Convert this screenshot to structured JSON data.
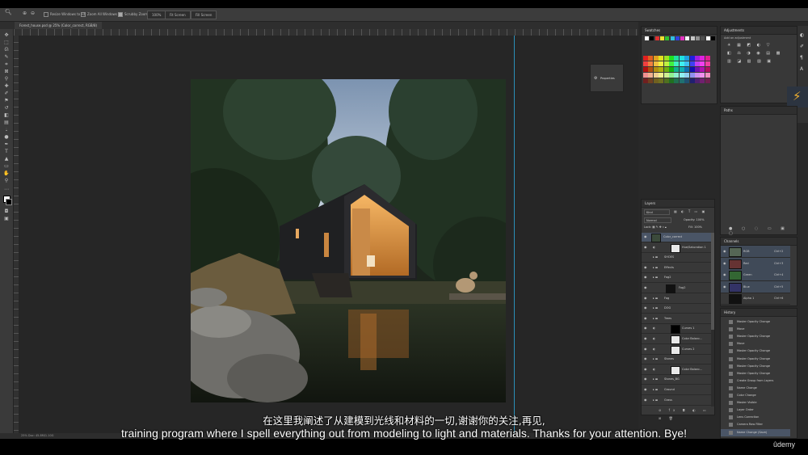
{
  "options_bar": {
    "resize_windows": "Resize Windows to Fit",
    "zoom_all_windows": "Zoom All Windows",
    "scrubby_zoom": "Scrubby Zoom",
    "zoom_100": "100%",
    "fit_screen": "Fit Screen",
    "fill_screen": "Fill Screen"
  },
  "document": {
    "tab_title": "Forest_house.psd @ 25% (Color_correct, RGB/8)",
    "status": "25%    Doc: 45.8M/1.10G"
  },
  "properties_panel": {
    "label": "Properties"
  },
  "swatches_panel": {
    "title": "Swatches",
    "top_row": [
      "#ffffff",
      "#000000",
      "#e03030",
      "#f0e030",
      "#30c030",
      "#30c0e0",
      "#3040e0",
      "#e030c0",
      "#f4f4f4",
      "#c8c8c8",
      "#909090",
      "#505050",
      "#ffffff",
      "#000000"
    ],
    "grid": [
      [
        "#e02020",
        "#e06020",
        "#e0a020",
        "#e0e020",
        "#a0e020",
        "#20e020",
        "#20e0a0",
        "#20e0e0",
        "#20a0e0",
        "#2020e0",
        "#a020e0",
        "#e020e0",
        "#e02090"
      ],
      [
        "#f04040",
        "#f08040",
        "#f0c040",
        "#f0f040",
        "#c0f040",
        "#40f040",
        "#40f0c0",
        "#40f0f0",
        "#40c0f0",
        "#4040f0",
        "#c040f0",
        "#f040f0",
        "#f040a0"
      ],
      [
        "#b01010",
        "#b05010",
        "#b09010",
        "#b0b010",
        "#70b010",
        "#10b010",
        "#10b090",
        "#10b0b0",
        "#1070b0",
        "#1010b0",
        "#7010b0",
        "#b010b0",
        "#b01060"
      ],
      [
        "#f09090",
        "#f0b090",
        "#f0d090",
        "#f0f090",
        "#d0f090",
        "#90f090",
        "#90f0d0",
        "#90f0f0",
        "#90d0f0",
        "#9090f0",
        "#d090f0",
        "#f090f0",
        "#f090c0"
      ],
      [
        "#702020",
        "#704020",
        "#706020",
        "#707020",
        "#507020",
        "#207020",
        "#207050",
        "#207070",
        "#205070",
        "#202070",
        "#502070",
        "#702070",
        "#702050"
      ]
    ]
  },
  "adjustments_panel": {
    "title": "Adjustments",
    "subtitle": "Add an adjustment"
  },
  "paths_panel": {
    "title": "Paths"
  },
  "layers_panel": {
    "title": "Layers",
    "kind": "Kind",
    "blend_mode": "Normal",
    "opacity_label": "Opacity:",
    "opacity_value": "100%",
    "lock_label": "Lock:",
    "fill_label": "Fill:",
    "fill_value": "100%",
    "layers": [
      {
        "name": "Color_correct",
        "type": "image"
      },
      {
        "name": "Hue/Saturation 1",
        "type": "adjustment"
      },
      {
        "name": "SHOES",
        "type": "group"
      },
      {
        "name": "Effects",
        "type": "group"
      },
      {
        "name": "Fog2",
        "type": "group"
      },
      {
        "name": "Fog2",
        "type": "mask"
      },
      {
        "name": "Fog",
        "type": "group"
      },
      {
        "name": "DOG",
        "type": "group"
      },
      {
        "name": "Trees",
        "type": "group"
      },
      {
        "name": "Curves 1",
        "type": "adjustment"
      },
      {
        "name": "Color Balanc...",
        "type": "adjustment"
      },
      {
        "name": "Curves 2",
        "type": "adjustment"
      },
      {
        "name": "Stones",
        "type": "group"
      },
      {
        "name": "Color Balanc...",
        "type": "adjustment"
      },
      {
        "name": "Stones_BG",
        "type": "group"
      },
      {
        "name": "Ground",
        "type": "group"
      },
      {
        "name": "Grass",
        "type": "group"
      }
    ]
  },
  "channels_panel": {
    "title": "Channels",
    "channels": [
      {
        "name": "RGB",
        "shortcut": "Ctrl+2"
      },
      {
        "name": "Red",
        "shortcut": "Ctrl+3"
      },
      {
        "name": "Green",
        "shortcut": "Ctrl+4"
      },
      {
        "name": "Blue",
        "shortcut": "Ctrl+5"
      },
      {
        "name": "Alpha 1",
        "shortcut": "Ctrl+6"
      }
    ]
  },
  "history_panel": {
    "title": "History",
    "items": [
      "Master Opacity Change",
      "Move",
      "Master Opacity Change",
      "Move",
      "Master Opacity Change",
      "Master Opacity Change",
      "Master Opacity Change",
      "Master Opacity Change",
      "Create Group from Layers",
      "Name Change",
      "Color Change",
      "Master Visible",
      "Layer Order",
      "Lens Correction",
      "Camera Raw Filter",
      "Name Change (Save)"
    ]
  },
  "subtitles": {
    "zh": "在这里我阐述了从建模到光线和材料的一切,谢谢你的关注,再见,",
    "en": "training program where I spell everything out from modeling to light and materials. Thanks for your attention. Bye!"
  },
  "watermark": "ûdemy",
  "colors": {
    "accent": "#2a8fb8",
    "selection": "#4a5566",
    "panel": "#383838",
    "bg": "#282828"
  }
}
